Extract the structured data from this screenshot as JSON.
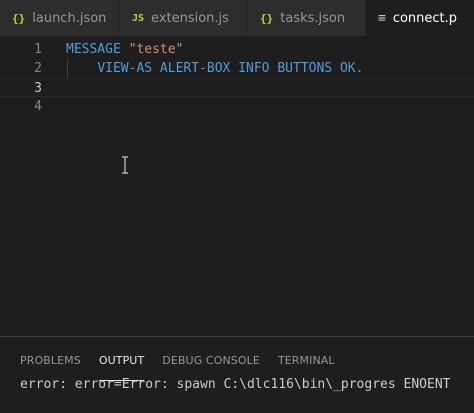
{
  "tabs": [
    {
      "icon": "{}",
      "label": "launch.json"
    },
    {
      "icon": "JS",
      "label": "extension.js"
    },
    {
      "icon": "{}",
      "label": "tasks.json"
    },
    {
      "icon": "≡",
      "label": "connect.p"
    }
  ],
  "editor": {
    "line_numbers": [
      "1",
      "2",
      "3",
      "4"
    ],
    "line1": {
      "keyword": "MESSAGE",
      "string": "\"teste\""
    },
    "line2": {
      "indent": "    ",
      "code": "VIEW-AS ALERT-BOX INFO BUTTONS OK."
    }
  },
  "panel": {
    "tabs": [
      "PROBLEMS",
      "OUTPUT",
      "DEBUG CONSOLE",
      "TERMINAL"
    ],
    "output_text": "error: error=Error: spawn C:\\dlc116\\bin\\_progres ENOENT"
  },
  "colors": {
    "keyword": "#569cd6",
    "string": "#ce9178",
    "background": "#1e1e1e"
  }
}
